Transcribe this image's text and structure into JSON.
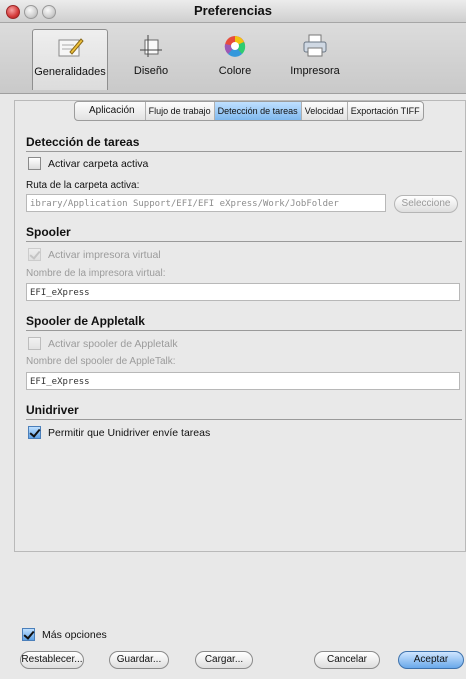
{
  "window": {
    "title": "Preferencias"
  },
  "toolbar": {
    "items": [
      {
        "label": "Generalidades",
        "icon": "general-icon",
        "selected": true
      },
      {
        "label": "Diseño",
        "icon": "layout-icon",
        "selected": false
      },
      {
        "label": "Colore",
        "icon": "color-wheel-icon",
        "selected": false
      },
      {
        "label": "Impresora",
        "icon": "printer-icon",
        "selected": false
      }
    ]
  },
  "tabs": [
    {
      "label": "Aplicación",
      "active": false
    },
    {
      "label": "Flujo de trabajo",
      "active": false
    },
    {
      "label": "Detección de tareas",
      "active": true
    },
    {
      "label": "Velocidad",
      "active": false
    },
    {
      "label": "Exportación TIFF",
      "active": false
    }
  ],
  "task_detection": {
    "heading": "Detección de tareas",
    "activate_hot_folder": {
      "label": "Activar carpeta activa",
      "checked": false
    },
    "path_label": "Ruta de la carpeta activa:",
    "path_value": "ibrary/Application Support/EFI/EFI eXpress/Work/JobFolder",
    "select_button": "Seleccione"
  },
  "spooler": {
    "heading": "Spooler",
    "activate_virtual_printer": {
      "label": "Activar impresora virtual",
      "checked": true,
      "enabled": false
    },
    "name_label": "Nombre de la impresora virtual:",
    "name_value": "EFI_eXpress"
  },
  "appletalk_spooler": {
    "heading": "Spooler de Appletalk",
    "activate": {
      "label": "Activar spooler de Appletalk",
      "checked": false,
      "enabled": false
    },
    "name_label": "Nombre del spooler de AppleTalk:",
    "name_value": "EFI_eXpress"
  },
  "unidriver": {
    "heading": "Unidriver",
    "allow_jobs": {
      "label": "Permitir que Unidriver envíe tareas",
      "checked": true
    }
  },
  "footer": {
    "more_options": {
      "label": "Más opciones",
      "checked": true
    },
    "buttons": {
      "reset": "Restablecer...",
      "save": "Guardar...",
      "load": "Cargar...",
      "cancel": "Cancelar",
      "accept": "Aceptar"
    }
  },
  "colors": {
    "accent": "#6fb0ee",
    "window_bg": "#e8e8e8"
  }
}
